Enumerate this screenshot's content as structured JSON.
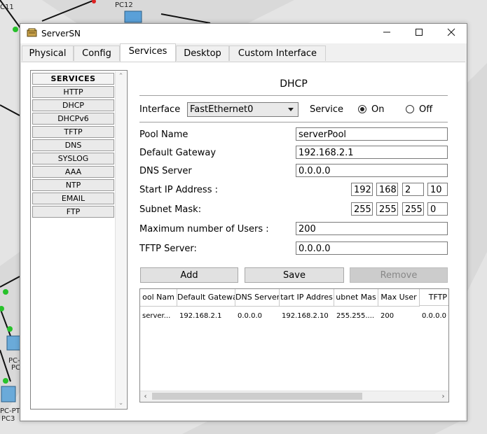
{
  "window": {
    "title": "ServerSN",
    "minimize_icon": "minimize-icon",
    "maximize_icon": "maximize-icon",
    "close_icon": "close-icon"
  },
  "background_labels": [
    "C11",
    "PC12",
    "PC-",
    "PC",
    "PC-PT",
    "PC3"
  ],
  "tabs": [
    {
      "label": "Physical"
    },
    {
      "label": "Config"
    },
    {
      "label": "Services",
      "active": true
    },
    {
      "label": "Desktop"
    },
    {
      "label": "Custom Interface"
    }
  ],
  "services": {
    "header": "SERVICES",
    "items": [
      "HTTP",
      "DHCP",
      "DHCPv6",
      "TFTP",
      "DNS",
      "SYSLOG",
      "AAA",
      "NTP",
      "EMAIL",
      "FTP"
    ]
  },
  "dhcp": {
    "heading": "DHCP",
    "interface_label": "Interface",
    "interface_value": "FastEthernet0",
    "service_label": "Service",
    "on_label": "On",
    "off_label": "Off",
    "service_state": "On",
    "pool_name_label": "Pool Name",
    "pool_name_value": "serverPool",
    "gateway_label": "Default Gateway",
    "gateway_value": "192.168.2.1",
    "dns_label": "DNS Server",
    "dns_value": "0.0.0.0",
    "start_ip_label": "Start IP Address :",
    "start_ip": [
      "192",
      "168",
      "2",
      "10"
    ],
    "subnet_label": "Subnet Mask:",
    "subnet": [
      "255",
      "255",
      "255",
      "0"
    ],
    "max_users_label": "Maximum number of Users :",
    "max_users_value": "200",
    "tftp_label": "TFTP Server:",
    "tftp_value": "0.0.0.0",
    "add_label": "Add",
    "save_label": "Save",
    "remove_label": "Remove"
  },
  "table": {
    "headers": [
      "ool Nam",
      "Default Gatewa",
      "DNS Server",
      "tart IP Addres",
      "ubnet Mas",
      "Max User",
      "TFTP"
    ],
    "rows": [
      [
        "server...",
        "192.168.2.1",
        "0.0.0.0",
        "192.168.2.10",
        "255.255....",
        "200",
        "0.0.0.0"
      ]
    ]
  }
}
